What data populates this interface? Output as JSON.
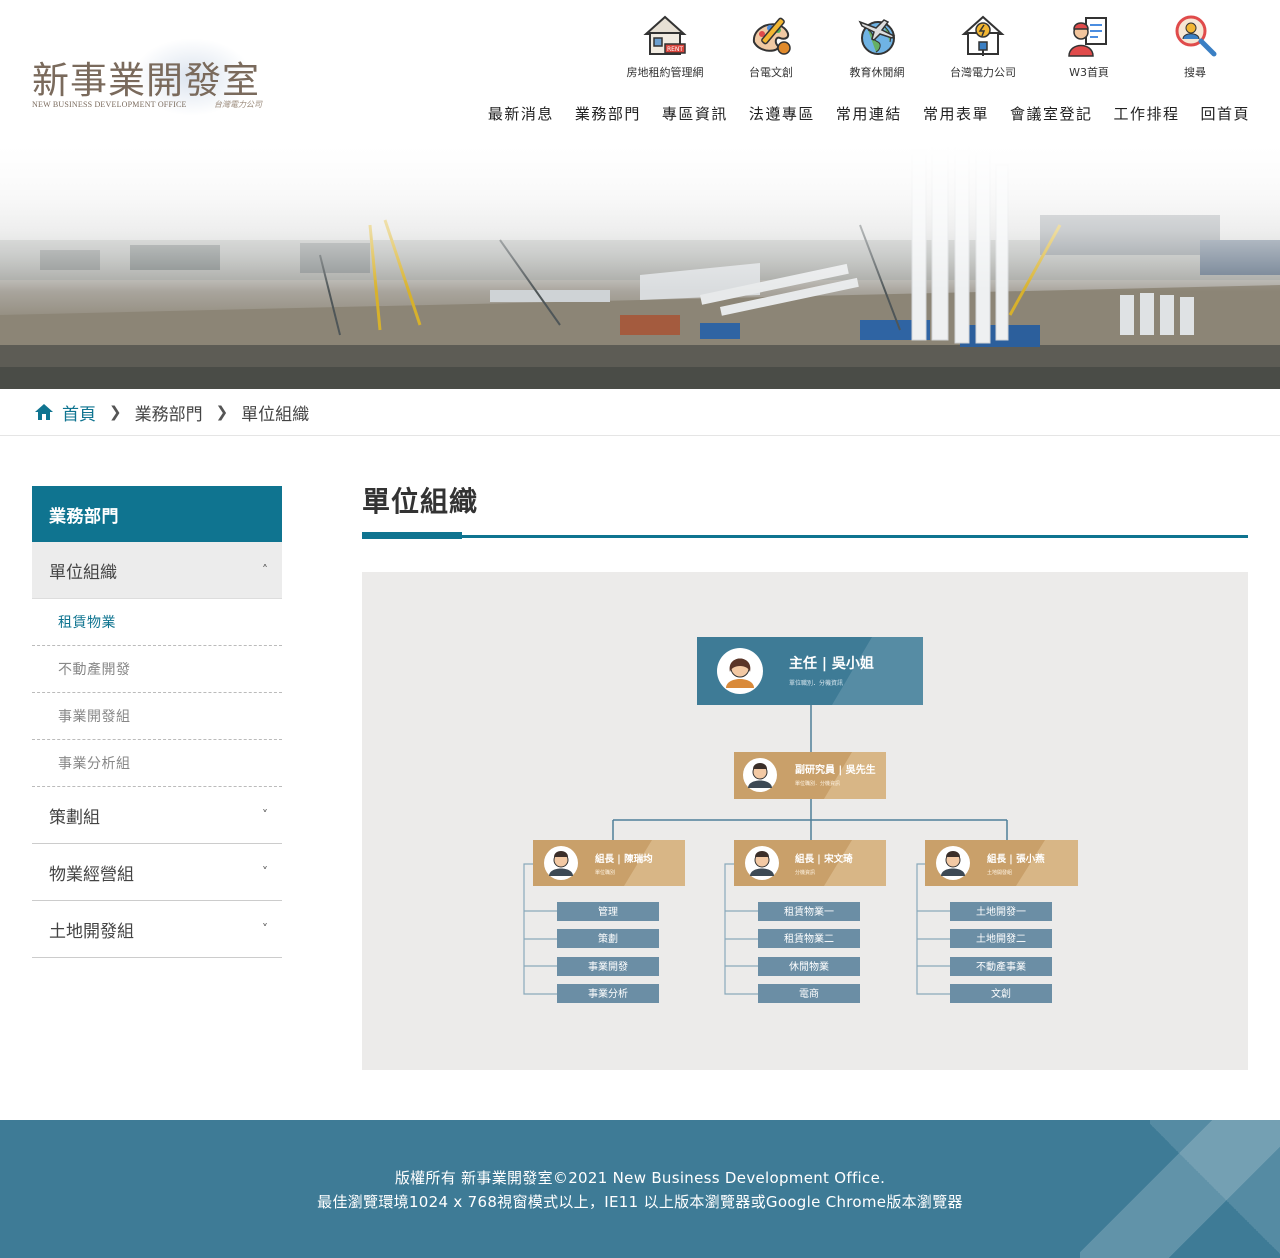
{
  "logo": {
    "name_cn": "新事業開發室",
    "name_en": "NEW BUSINESS DEVELOPMENT OFFICE",
    "signature": "台灣電力公司"
  },
  "quick_links": [
    {
      "label": "房地租約管理網",
      "icon": "rent-house-icon"
    },
    {
      "label": "台電文創",
      "icon": "creative-tools-icon"
    },
    {
      "label": "教育休閒網",
      "icon": "globe-plane-icon"
    },
    {
      "label": "台灣電力公司",
      "icon": "power-house-icon"
    },
    {
      "label": "W3首頁",
      "icon": "worker-document-icon"
    },
    {
      "label": "搜尋",
      "icon": "search-user-icon"
    }
  ],
  "main_nav": [
    "最新消息",
    "業務部門",
    "專區資訊",
    "法遵專區",
    "常用連結",
    "常用表單",
    "會議室登記",
    "工作排程",
    "回首頁"
  ],
  "breadcrumb": {
    "home": "首頁",
    "level1": "業務部門",
    "level2": "單位組織"
  },
  "sidebar": {
    "title": "業務部門",
    "active": "單位組織",
    "sub_items": [
      "租賃物業",
      "不動產開發",
      "事業開發組",
      "事業分析組"
    ],
    "categories": [
      "策劃組",
      "物業經營組",
      "土地開發組"
    ]
  },
  "page_title": "單位組織",
  "org_chart": {
    "director": {
      "title": "主任 | 吳小姐",
      "desc": "單位職別．分機資訊"
    },
    "deputy": {
      "title": "副研究員 | 吳先生",
      "desc": "單位職別．分機資訊"
    },
    "groups": [
      {
        "leader": "組長 | 陳瑞均",
        "desc": "單位職別",
        "units": [
          "管理",
          "策劃",
          "事業開發",
          "事業分析"
        ]
      },
      {
        "leader": "組長 | 宋文琦",
        "desc": "分機資訊",
        "units": [
          "租賃物業一",
          "租賃物業二",
          "休閒物業",
          "電商"
        ]
      },
      {
        "leader": "組長 | 張小燕",
        "desc": "土地開發組",
        "units": [
          "土地開發一",
          "土地開發二",
          "不動產事業",
          "文創"
        ]
      }
    ]
  },
  "colors": {
    "primary": "#0f7490",
    "director_box": "#3e7b96",
    "leader_box": "#c9a06a",
    "unit_box": "#6b8ea5",
    "footer": "#3e7b96"
  },
  "footer": {
    "line1": "版權所有 新事業開發室©2021 New Business Development Office.",
    "line2": "最佳瀏覽環境1024 x 768視窗模式以上，IE11 以上版本瀏覽器或Google Chrome版本瀏覽器"
  }
}
